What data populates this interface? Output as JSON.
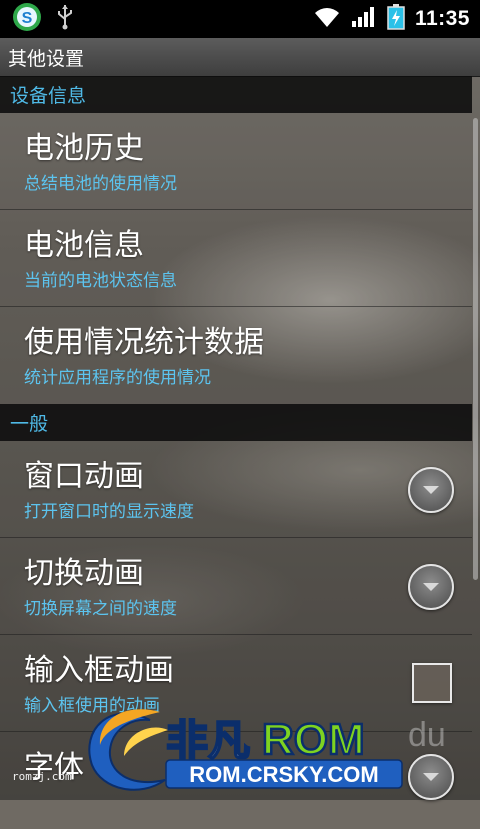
{
  "status_bar": {
    "app_icon": "sogou-s-icon",
    "usb_icon": "usb-icon",
    "wifi_icon": "wifi-icon",
    "signal_icon": "signal-icon",
    "battery_icon": "battery-charging-icon",
    "time": "11:35"
  },
  "title": "其他设置",
  "sections": [
    {
      "header": "设备信息",
      "items": [
        {
          "title": "电池历史",
          "summary": "总结电池的使用情况"
        },
        {
          "title": "电池信息",
          "summary": "当前的电池状态信息"
        },
        {
          "title": "使用情况统计数据",
          "summary": "统计应用程序的使用情况"
        }
      ]
    },
    {
      "header": "一般",
      "items": [
        {
          "title": "窗口动画",
          "summary": "打开窗口时的显示速度",
          "control": "dropdown"
        },
        {
          "title": "切换动画",
          "summary": "切换屏幕之间的速度",
          "control": "dropdown"
        },
        {
          "title": "输入框动画",
          "summary": "输入框使用的动画",
          "control": "checkbox",
          "checked": false
        },
        {
          "title": "字体",
          "summary": "",
          "control": "dropdown"
        }
      ]
    }
  ],
  "watermark": {
    "brand": "非凡ROM",
    "brand_cn": "非凡",
    "brand_rom": "ROM",
    "url": "ROM.CRSKY.COM",
    "small": "romzj.com",
    "faded": "du"
  },
  "colors": {
    "accent": "#4fb9e6",
    "summary": "#5cc4ef",
    "watermark_green": "#7ed321",
    "watermark_blue": "#1f5fbf"
  }
}
